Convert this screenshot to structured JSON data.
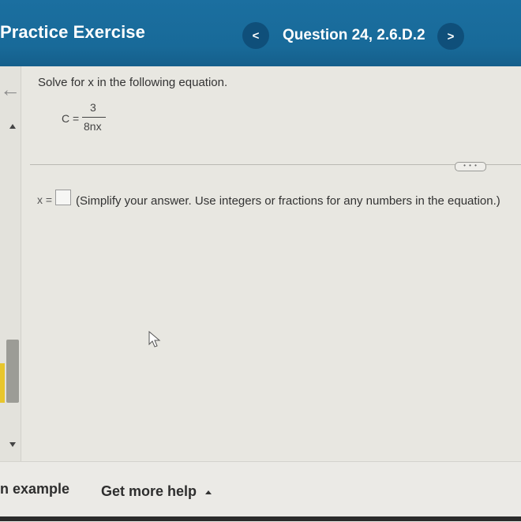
{
  "header": {
    "title": "Practice Exercise",
    "question_label": "Question 24, 2.6.D.2",
    "prev_glyph": "<",
    "next_glyph": ">"
  },
  "sidebar": {
    "back_glyph": "←"
  },
  "problem": {
    "instruction": "Solve for x in the following equation.",
    "equation_lhs": "C =",
    "numerator": "3",
    "denominator": "8nx",
    "more_glyph": "• • •",
    "answer_prefix": "x =",
    "answer_value": "",
    "answer_hint": "(Simplify your answer. Use integers or fractions for any numbers in the equation.)"
  },
  "footer": {
    "example_label": "n example",
    "help_label": "Get more help"
  },
  "colors": {
    "header_bg": "#1b6fa0",
    "nav_button_bg": "#0f4f7a",
    "scroll_accent": "#e8c62c"
  },
  "icons": {
    "prev": "chevron-left-icon",
    "next": "chevron-right-icon",
    "back": "arrow-left-icon",
    "more": "ellipsis-icon",
    "cursor": "mouse-pointer-icon"
  }
}
